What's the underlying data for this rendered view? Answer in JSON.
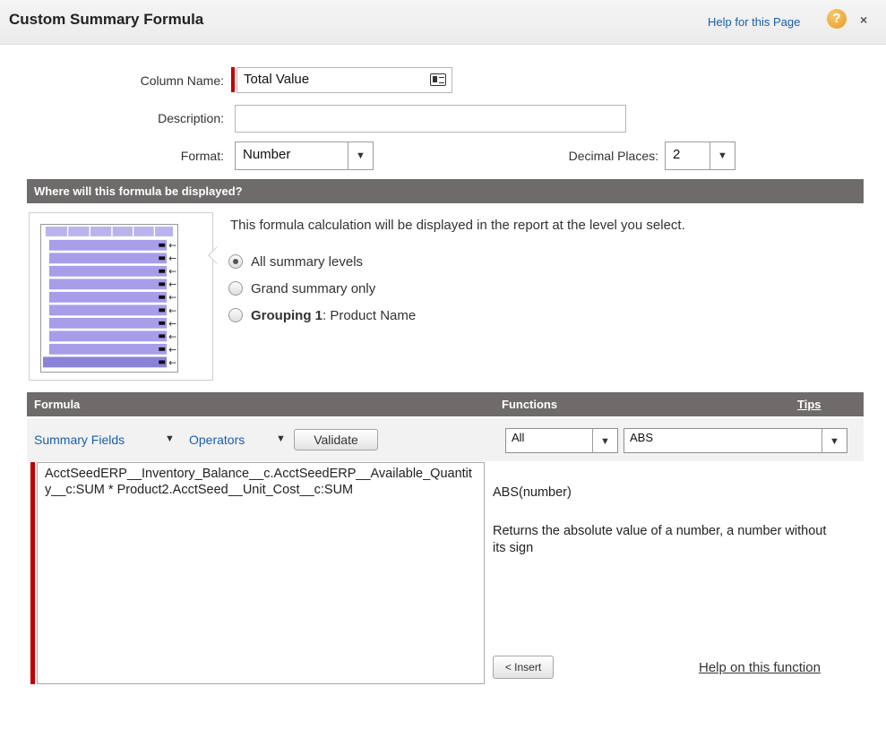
{
  "header": {
    "title": "Custom Summary Formula",
    "help_label": "Help for this Page",
    "help_icon": "?",
    "close_icon": "×"
  },
  "form": {
    "column_name_label": "Column Name:",
    "column_name_value": "Total Value",
    "description_label": "Description:",
    "description_value": "",
    "format_label": "Format:",
    "format_value": "Number",
    "decimal_label": "Decimal Places:",
    "decimal_value": "2"
  },
  "display_section": {
    "title": "Where will this formula be displayed?",
    "intro": "This formula calculation will be displayed in the report at the level you select.",
    "options": [
      {
        "label": "All summary levels",
        "selected": true
      },
      {
        "label": "Grand summary only",
        "selected": false
      },
      {
        "label_bold": "Grouping 1",
        "label_rest": ": Product Name",
        "selected": false
      }
    ]
  },
  "formula_section": {
    "formula_title": "Formula",
    "functions_title": "Functions",
    "tips_label": "Tips",
    "summary_fields_label": "Summary Fields",
    "operators_label": "Operators",
    "validate_label": "Validate",
    "function_category": "All",
    "function_selected": "ABS",
    "formula_text": "AcctSeedERP__Inventory_Balance__c.AcctSeedERP__Available_Quantity__c:SUM * Product2.AcctSeed__Unit_Cost__c:SUM",
    "function_signature": "ABS(number)",
    "function_description": "Returns the absolute value of a number, a number without its sign",
    "insert_label": "< Insert",
    "help_function_label": "Help on this function"
  }
}
